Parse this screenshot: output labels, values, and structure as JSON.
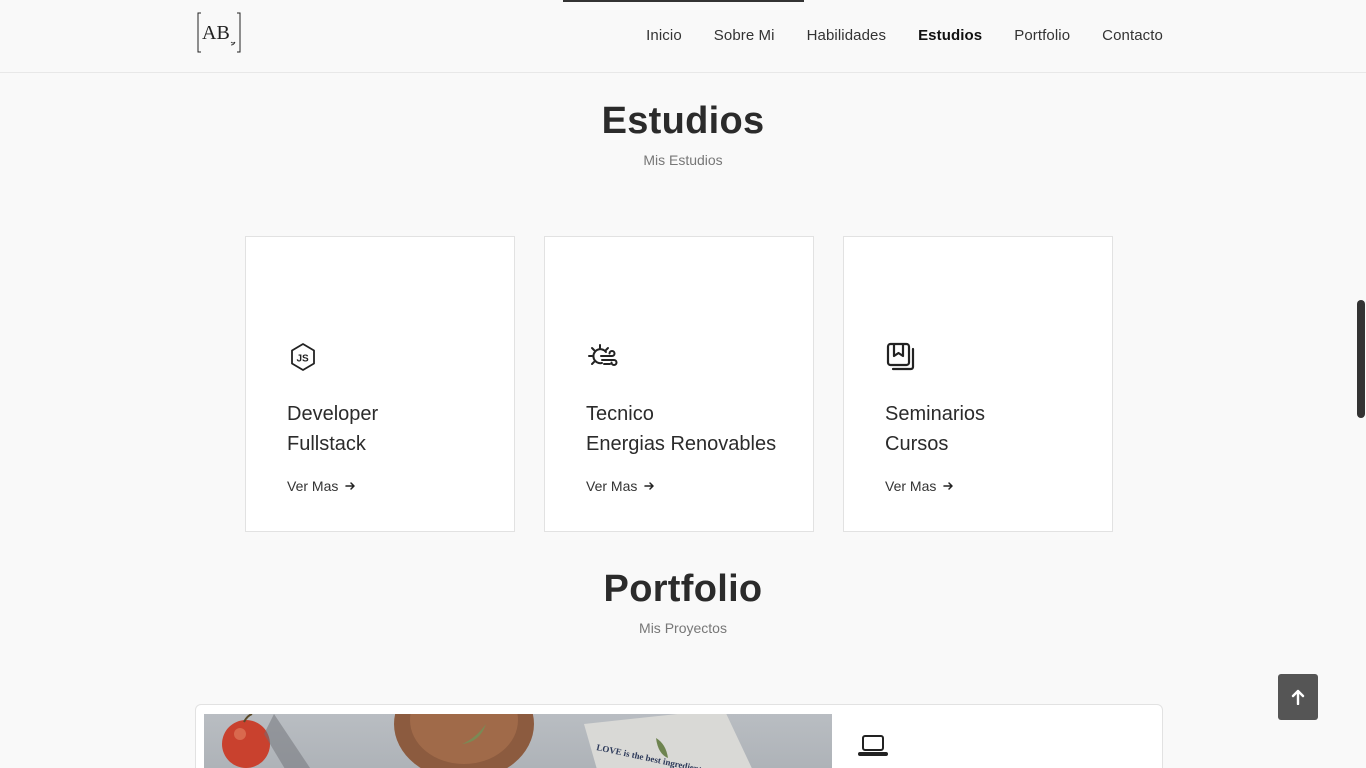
{
  "header": {
    "logo_text": "AB",
    "nav": [
      {
        "label": "Inicio",
        "active": false
      },
      {
        "label": "Sobre Mi",
        "active": false
      },
      {
        "label": "Habilidades",
        "active": false
      },
      {
        "label": "Estudios",
        "active": true
      },
      {
        "label": "Portfolio",
        "active": false
      },
      {
        "label": "Contacto",
        "active": false
      }
    ]
  },
  "studies": {
    "title": "Estudios",
    "subtitle": "Mis Estudios",
    "cards": [
      {
        "icon": "nodejs-icon",
        "title_line1": "Developer",
        "title_line2": "Fullstack",
        "link": "Ver Mas"
      },
      {
        "icon": "sun-wind-icon",
        "title_line1": "Tecnico",
        "title_line2": "Energias Renovables",
        "link": "Ver Mas"
      },
      {
        "icon": "bookmarks-icon",
        "title_line1": "Seminarios",
        "title_line2": "Cursos",
        "link": "Ver Mas"
      }
    ]
  },
  "portfolio": {
    "title": "Portfolio",
    "subtitle": "Mis Proyectos",
    "project_icon": "laptop-icon",
    "image_text": "LOVE is the best ingredient"
  },
  "colors": {
    "background": "#f9f9f9",
    "card": "#ffffff",
    "text": "#2b2b2b",
    "scroll_button": "#555555"
  }
}
